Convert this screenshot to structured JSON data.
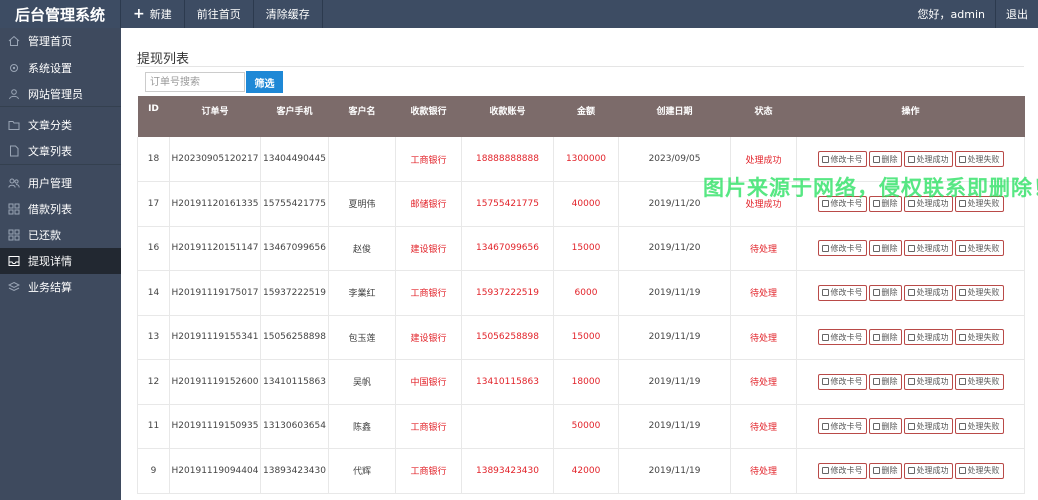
{
  "brand": "后台管理系统",
  "topnav": [
    {
      "label": "新建",
      "icon": "plus-icon"
    },
    {
      "label": "前往首页"
    },
    {
      "label": "清除缓存"
    }
  ],
  "greeting": "您好，admin",
  "logout": "退出",
  "sidebar": {
    "items": [
      {
        "label": "管理首页",
        "icon": "home-icon"
      },
      {
        "label": "系统设置",
        "icon": "gear-icon"
      },
      {
        "label": "网站管理员",
        "icon": "user-icon"
      },
      {
        "label": "文章分类",
        "icon": "folder-icon"
      },
      {
        "label": "文章列表",
        "icon": "file-icon"
      },
      {
        "label": "用户管理",
        "icon": "users-icon"
      },
      {
        "label": "借款列表",
        "icon": "grid-icon"
      },
      {
        "label": "已还款",
        "icon": "grid-icon"
      },
      {
        "label": "提现详情",
        "icon": "inbox-icon"
      },
      {
        "label": "业务结算",
        "icon": "layers-icon"
      }
    ],
    "active_index": 8
  },
  "page_title": "提现列表",
  "search": {
    "placeholder": "订单号搜索",
    "button": "筛选"
  },
  "table": {
    "headers": [
      "ID",
      "订单号",
      "客户手机",
      "客户名",
      "收款银行",
      "收款账号",
      "金额",
      "创建日期",
      "状态",
      "操作"
    ],
    "ops": [
      "修改卡号",
      "删除",
      "处理成功",
      "处理失败"
    ],
    "rows": [
      [
        "18",
        "H20230905120217",
        "13404490445",
        "",
        "工商银行",
        "18888888888",
        "1300000",
        "2023/09/05",
        "处理成功"
      ],
      [
        "17",
        "H20191120161335",
        "15755421775",
        "夏明伟",
        "邮储银行",
        "15755421775",
        "40000",
        "2019/11/20",
        "处理成功"
      ],
      [
        "16",
        "H20191120151147",
        "13467099656",
        "赵俊",
        "建设银行",
        "13467099656",
        "15000",
        "2019/11/20",
        "待处理"
      ],
      [
        "14",
        "H20191119175017",
        "15937222519",
        "李業红",
        "工商银行",
        "15937222519",
        "6000",
        "2019/11/19",
        "待处理"
      ],
      [
        "13",
        "H20191119155341",
        "15056258898",
        "包玉莲",
        "建设银行",
        "15056258898",
        "15000",
        "2019/11/19",
        "待处理"
      ],
      [
        "12",
        "H20191119152600",
        "13410115863",
        "吴帆",
        "中国银行",
        "13410115863",
        "18000",
        "2019/11/19",
        "待处理"
      ],
      [
        "11",
        "H20191119150935",
        "13130603654",
        "陈鑫",
        "工商银行",
        "",
        "50000",
        "2019/11/19",
        "待处理"
      ],
      [
        "9",
        "H20191119094404",
        "13893423430",
        "代辉",
        "工商银行",
        "13893423430",
        "42000",
        "2019/11/19",
        "待处理"
      ]
    ]
  },
  "watermark": "图片来源于网络，侵权联系即删除！",
  "colors": {
    "topbar": "#3d4c63",
    "sidebar": "#3e4a5e",
    "header": "#7c6b6a",
    "accent": "#1e88d6",
    "red": "#e2232a"
  }
}
